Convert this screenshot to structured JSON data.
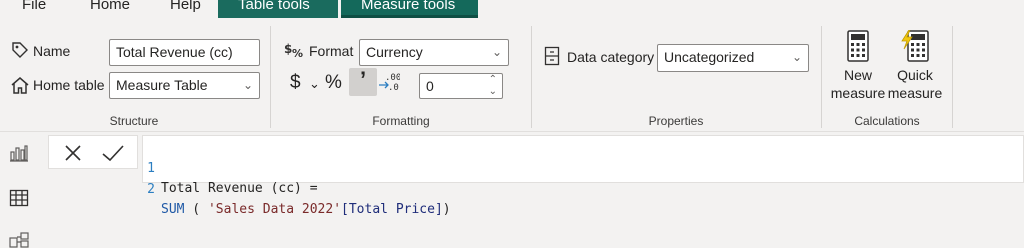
{
  "tabs": [
    {
      "label": "File"
    },
    {
      "label": "Home"
    },
    {
      "label": "Help"
    },
    {
      "label": "Table tools"
    },
    {
      "label": "Measure tools"
    }
  ],
  "structure": {
    "name_label": "Name",
    "name_value": "Total Revenue (cc)",
    "home_table_label": "Home table",
    "home_table_value": "Measure Table",
    "group_label": "Structure"
  },
  "formatting": {
    "format_label": "Format",
    "format_value": "Currency",
    "currency_symbol": "$",
    "percent_symbol": "%",
    "comma_symbol": "’",
    "decimal_places": "0",
    "group_label": "Formatting"
  },
  "properties": {
    "data_category_label": "Data category",
    "data_category_value": "Uncategorized",
    "group_label": "Properties"
  },
  "calculations": {
    "new_measure_line1": "New",
    "new_measure_line2": "measure",
    "quick_measure_line1": "Quick",
    "quick_measure_line2": "measure",
    "group_label": "Calculations"
  },
  "formula": {
    "lines": [
      {
        "num": "1",
        "text": "Total Revenue (cc) ="
      },
      {
        "num": "2",
        "func": "SUM",
        "open": " ( ",
        "table": "'Sales Data 2022'",
        "column": "[Total Price]",
        "close": ")"
      }
    ]
  },
  "icons": [
    "tag-icon",
    "home-icon",
    "format-icon",
    "data-category-icon",
    "calculator-icon",
    "quick-calculator-icon",
    "report-view-icon",
    "table-view-icon",
    "model-view-icon",
    "cancel-icon",
    "commit-icon"
  ]
}
